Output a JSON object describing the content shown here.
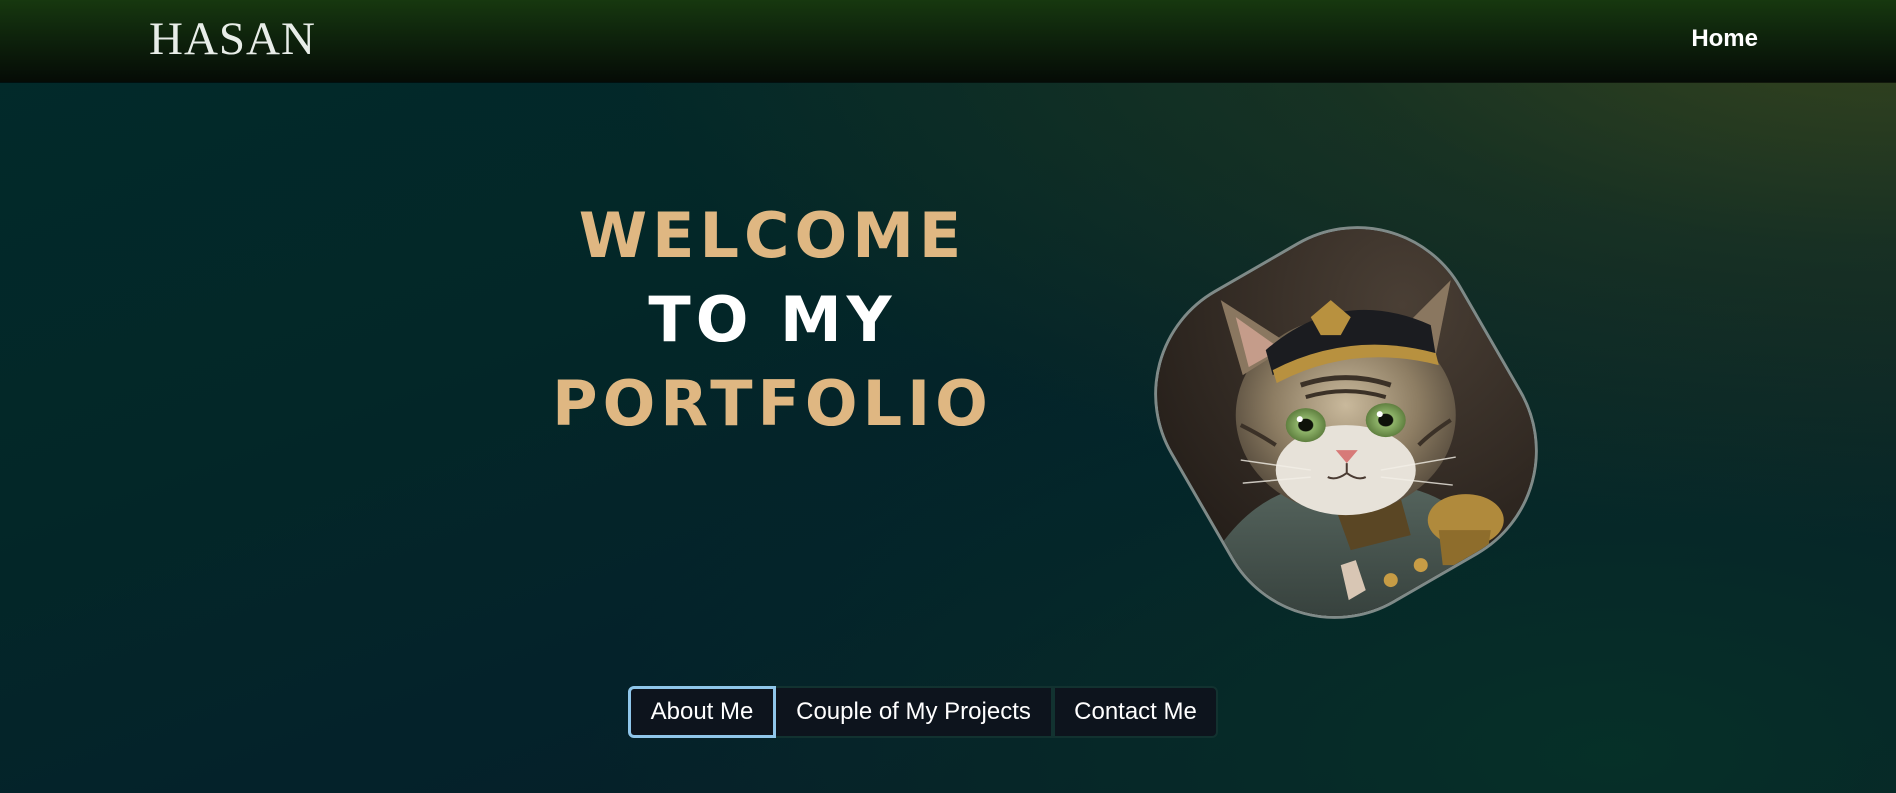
{
  "navbar": {
    "brand": "HASAN",
    "links": [
      {
        "label": "Home"
      }
    ]
  },
  "hero": {
    "title_lines": [
      "WELCOME",
      "TO MY",
      "PORTFOLIO"
    ],
    "title_colors": {
      "accent": "#dfb782",
      "primary": "#ffffff"
    }
  },
  "portrait": {
    "description_icon": "cat-in-uniform-portrait"
  },
  "buttons": [
    {
      "label": "About Me",
      "active": true
    },
    {
      "label": "Couple of My Projects",
      "active": false
    },
    {
      "label": "Contact Me",
      "active": false
    }
  ],
  "colors": {
    "navbar": "#0e230c",
    "background": "#032728",
    "active_button_border": "#8fc6ea",
    "button_bg": "#0d141d"
  }
}
